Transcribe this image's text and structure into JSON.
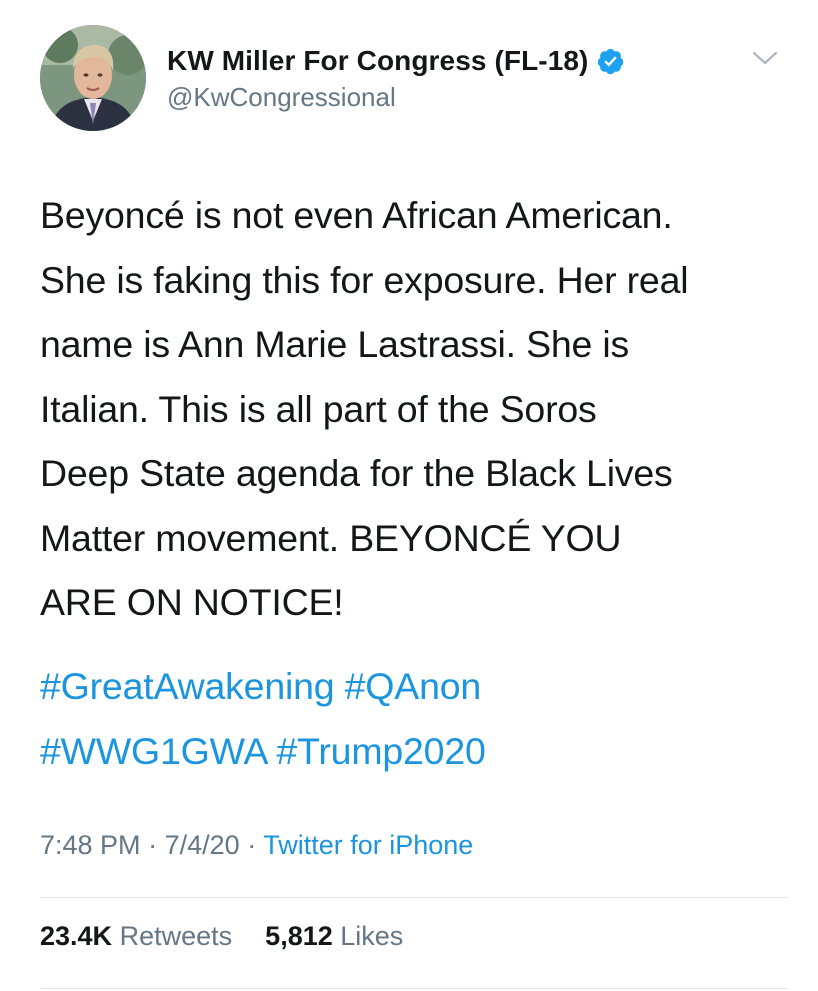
{
  "author": {
    "display_name": "KW Miller For Congress (FL-18)",
    "handle": "@KwCongressional",
    "verified": true,
    "avatar_icon": "profile-photo"
  },
  "tweet": {
    "text": "Beyoncé is not even African American.\nShe is faking this for exposure. Her real\nname is Ann Marie Lastrassi. She is\nItalian. This is all part of the Soros\nDeep State agenda for the Black Lives\nMatter movement. BEYONCÉ YOU\nARE ON NOTICE!",
    "hashtags": [
      "#GreatAwakening",
      "#QAnon",
      "#WWG1GWA",
      "#Trump2020"
    ],
    "time": "7:48 PM",
    "date": "7/4/20",
    "separator": "·",
    "source": "Twitter for iPhone"
  },
  "stats": {
    "retweets_count": "23.4K",
    "retweets_label": "Retweets",
    "likes_count": "5,812",
    "likes_label": "Likes"
  },
  "colors": {
    "link": "#1b95e0",
    "secondary_text": "#657786",
    "primary_text": "#14171a",
    "divider": "#e1e8ed"
  }
}
